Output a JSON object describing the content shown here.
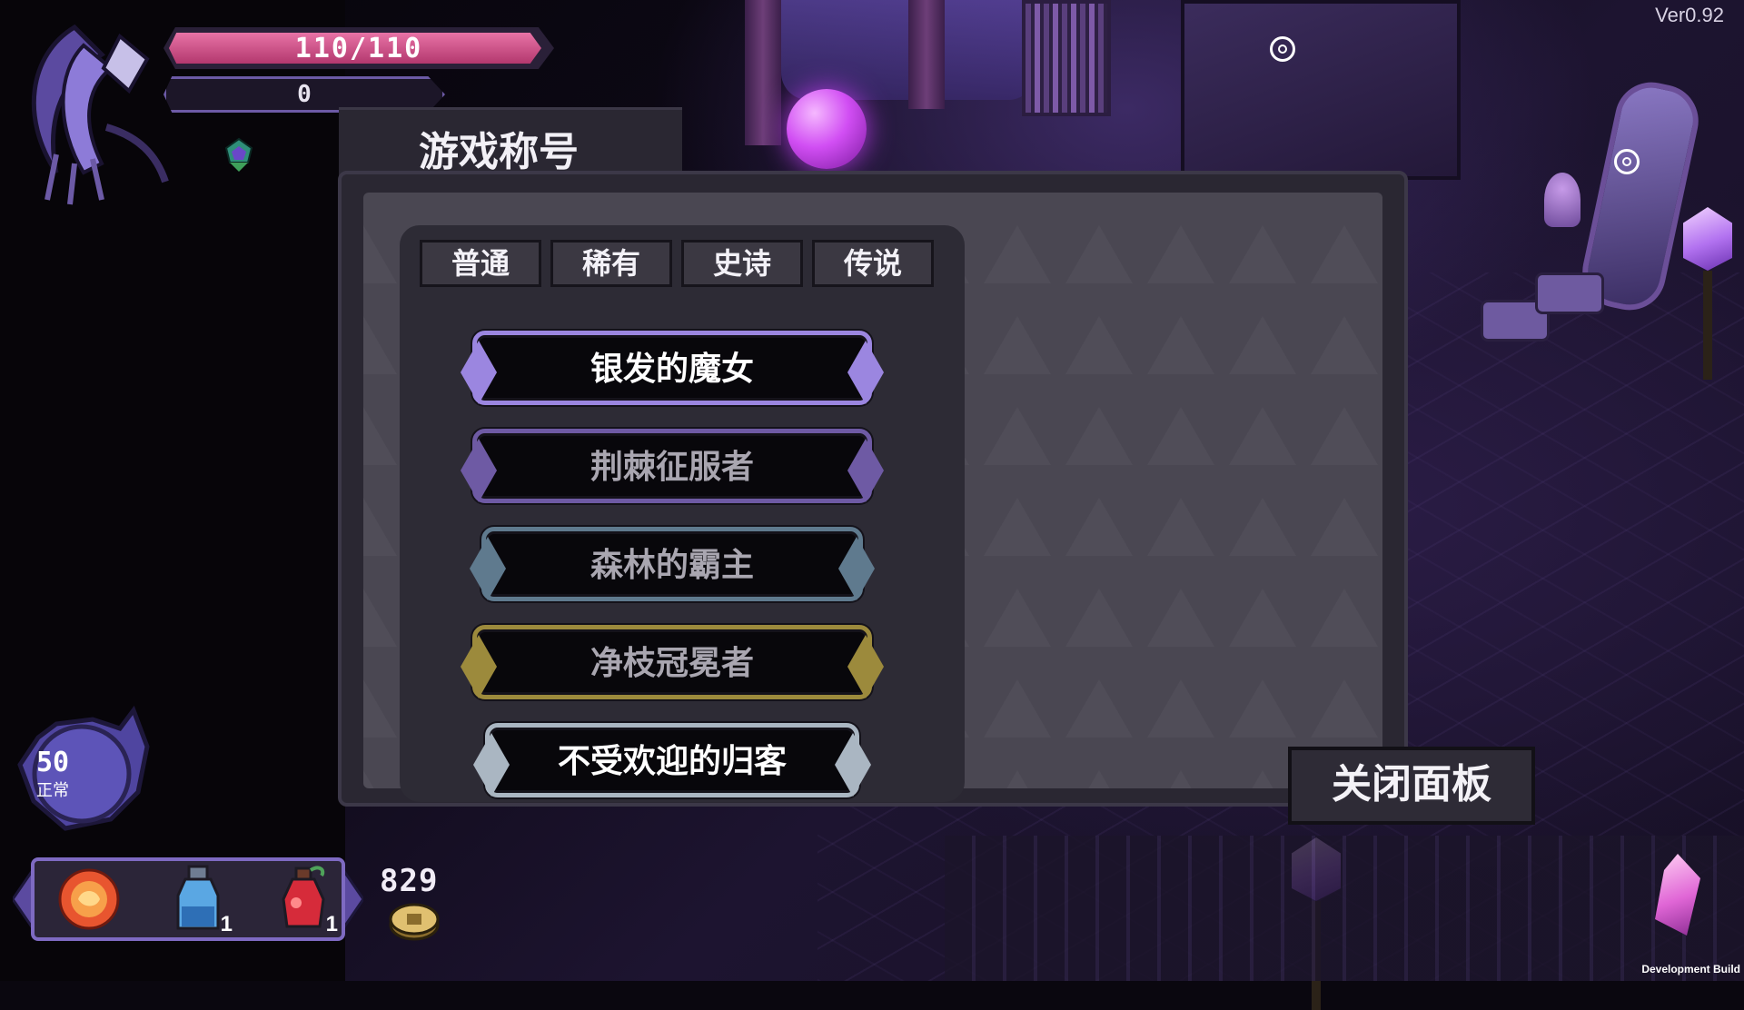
{
  "version": "Ver0.92",
  "build_label": "Development Build",
  "hud": {
    "hp_text": "110/110",
    "hp_fill": 1.0,
    "mp_text": "0",
    "status_value": "50",
    "status_label": "正常",
    "items": [
      {
        "icon": "fire-orb-icon",
        "count": ""
      },
      {
        "icon": "blue-potion-icon",
        "count": "1"
      },
      {
        "icon": "red-potion-icon",
        "count": "1"
      }
    ],
    "gold": "829"
  },
  "panel": {
    "title": "游戏称号",
    "tabs": [
      "普通",
      "稀有",
      "史诗",
      "传说"
    ],
    "titles": [
      {
        "label": "银发的魔女",
        "text_color": "#ffffff",
        "frame_color": "#9b86e0"
      },
      {
        "label": "荆棘征服者",
        "text_color": "#a9a6b0",
        "frame_color": "#6e5aa4"
      },
      {
        "label": "森林的霸主",
        "text_color": "#a9a6b0",
        "frame_color": "#5f7a8e"
      },
      {
        "label": "净枝冠冕者",
        "text_color": "#a9a6b0",
        "frame_color": "#9c8a3c"
      },
      {
        "label": "不受欢迎的归客",
        "text_color": "#ffffff",
        "frame_color": "#aab6c2"
      }
    ],
    "close_label": "关闭面板"
  },
  "colors": {
    "hp": "#d3508a",
    "mp_frame": "#6c5aa6",
    "panel_bg": "#2a2732"
  }
}
